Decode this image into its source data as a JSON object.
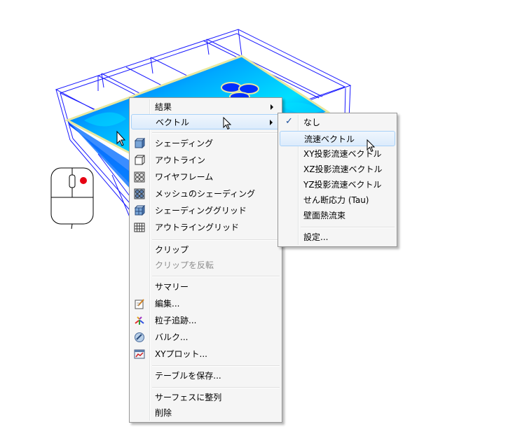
{
  "context_menu": {
    "items": [
      {
        "label": "結果",
        "submenu": true
      },
      {
        "label": "ベクトル",
        "submenu": true,
        "highlighted": true
      },
      {
        "label": "シェーディング",
        "icon": "shaded-cube-icon"
      },
      {
        "label": "アウトライン",
        "icon": "outline-cube-icon"
      },
      {
        "label": "ワイヤフレーム",
        "icon": "wireframe-cube-icon"
      },
      {
        "label": "メッシュのシェーディング",
        "icon": "mesh-shading-icon"
      },
      {
        "label": "シェーディンググリッド",
        "icon": "shading-grid-icon"
      },
      {
        "label": "アウトライングリッド",
        "icon": "outline-grid-icon"
      },
      {
        "label": "クリップ"
      },
      {
        "label": "クリップを反転",
        "disabled": true
      },
      {
        "label": "サマリー"
      },
      {
        "label": "編集...",
        "icon": "edit-icon"
      },
      {
        "label": "粒子追跡...",
        "icon": "particle-trace-icon"
      },
      {
        "label": "バルク...",
        "icon": "bulk-icon"
      },
      {
        "label": "XYプロット...",
        "icon": "xy-plot-icon"
      },
      {
        "label": "テーブルを保存..."
      },
      {
        "label": "サーフェスに整列"
      },
      {
        "label": "削除"
      }
    ]
  },
  "vector_submenu": {
    "items": [
      {
        "label": "なし",
        "checked": true
      },
      {
        "label": "流速ベクトル",
        "highlighted": true
      },
      {
        "label": "XY投影流速ベクトル"
      },
      {
        "label": "XZ投影流速ベクトル"
      },
      {
        "label": "YZ投影流速ベクトル"
      },
      {
        "label": "せん断応力 (Tau)"
      },
      {
        "label": "壁面熱流束"
      },
      {
        "label": "設定..."
      }
    ]
  },
  "colors": {
    "wireframe": "#1a1aff",
    "surface_deep": "#0018ff",
    "surface_mid": "#00b4ff",
    "surface_edge": "#e8e8a0",
    "mouse_button": "#e60012"
  }
}
